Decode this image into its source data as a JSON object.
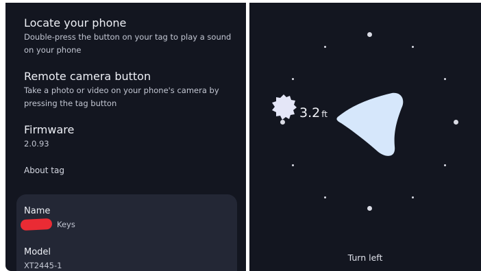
{
  "settings": {
    "locate": {
      "title": "Locate your phone",
      "description": "Double-press the button on your tag to play a sound on your phone"
    },
    "remote_camera": {
      "title": "Remote camera button",
      "description": "Take a photo or video on your phone's camera by pressing the tag button"
    },
    "firmware": {
      "title": "Firmware",
      "version": "2.0.93"
    },
    "about_tag": "About tag"
  },
  "tag_info": {
    "name_label": "Name",
    "name_value": "Keys",
    "model_label": "Model",
    "model_value": "XT2445-1"
  },
  "finder": {
    "distance_value": "3.2",
    "distance_unit": "ft",
    "instruction": "Turn left"
  },
  "colors": {
    "panel_bg": "#131620",
    "card_bg": "#232735",
    "arrow_fill": "#d6e7fb",
    "redaction": "#ea2b34"
  },
  "icons": {
    "tag": "tag-blob-icon",
    "direction": "direction-arrow-icon",
    "ring": "compass-ring-dots"
  }
}
